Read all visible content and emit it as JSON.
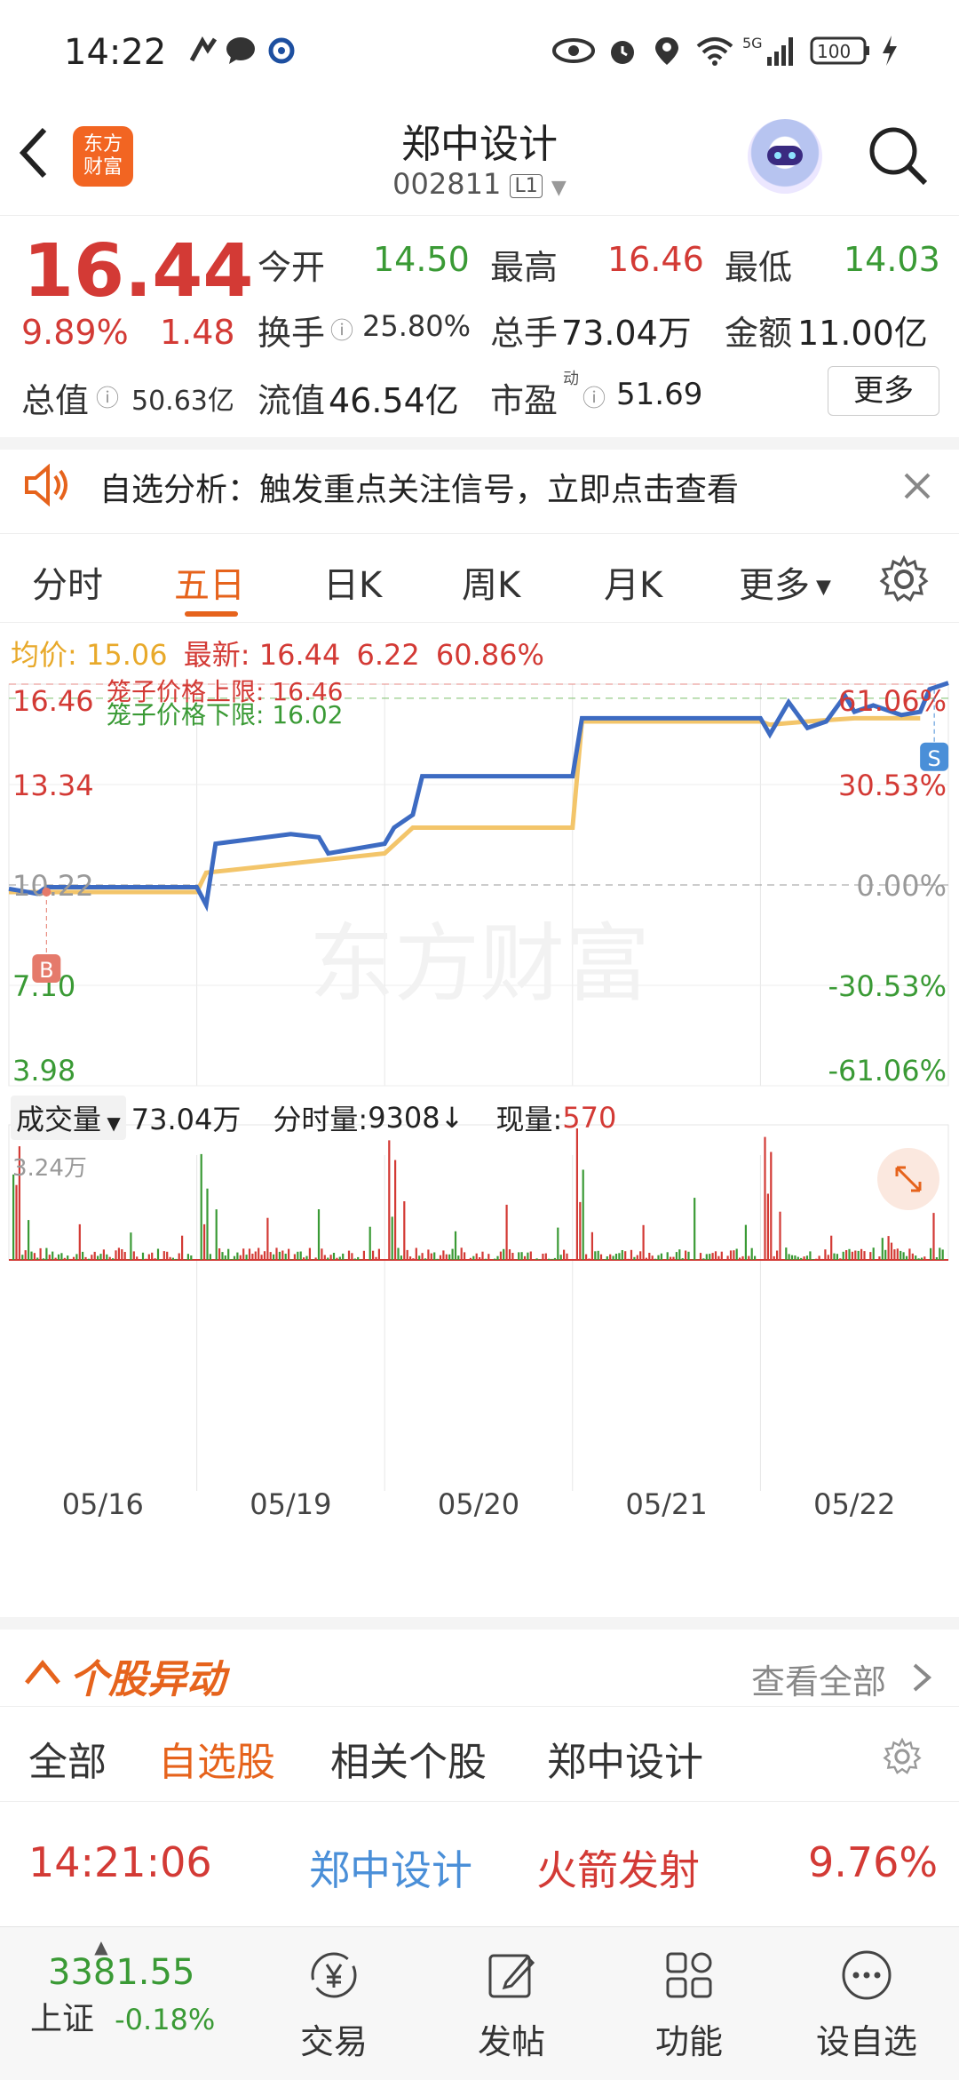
{
  "status_bar": {
    "time": "14:22",
    "battery": "100",
    "network": "5G"
  },
  "header": {
    "logo_text": "东方财富",
    "stock_name": "郑中设计",
    "stock_code": "002811",
    "level": "L1"
  },
  "quote": {
    "price": "16.44",
    "change_pct": "9.89%",
    "change_amt": "1.48",
    "stats": [
      {
        "label": "今开",
        "value": "14.50",
        "color": "green"
      },
      {
        "label": "最高",
        "value": "16.46",
        "color": "red"
      },
      {
        "label": "最低",
        "value": "14.03",
        "color": "green"
      },
      {
        "label": "换手",
        "value": "25.80%",
        "color": "dark"
      },
      {
        "label": "总手",
        "value": "73.04万",
        "color": "dark"
      },
      {
        "label": "金额",
        "value": "11.00亿",
        "color": "dark"
      },
      {
        "label": "总值",
        "value": "50.63亿",
        "color": "dark"
      },
      {
        "label": "流值",
        "value": "46.54亿",
        "color": "dark"
      },
      {
        "label": "市盈",
        "value": "51.69",
        "color": "dark",
        "superscript": "动"
      }
    ],
    "more_label": "更多"
  },
  "notice": {
    "text": "自选分析：触发重点关注信号，立即点击查看"
  },
  "tabs": [
    {
      "label": "分时",
      "active": false
    },
    {
      "label": "五日",
      "active": true
    },
    {
      "label": "日K",
      "active": false
    },
    {
      "label": "周K",
      "active": false
    },
    {
      "label": "月K",
      "active": false
    },
    {
      "label": "更多",
      "active": false
    }
  ],
  "info_line": {
    "avg_label": "均价:",
    "avg_value": "15.06",
    "latest_label": "最新:",
    "latest_value": "16.44",
    "change": "6.22",
    "change_pct": "60.86%"
  },
  "chart_data": {
    "type": "line",
    "title": "",
    "x": [
      "05/16",
      "05/19",
      "05/20",
      "05/21",
      "05/22"
    ],
    "price_axis": [
      "16.46",
      "13.34",
      "10.22",
      "7.10",
      "3.98"
    ],
    "pct_axis": [
      "61.06%",
      "30.53%",
      "0.00%",
      "-30.53%",
      "-61.06%"
    ],
    "ylim": [
      3.98,
      16.46
    ],
    "reference_price": 10.22,
    "cage_upper_label": "笼子价格上限: 16.46",
    "cage_lower_label": "笼子价格下限: 16.02",
    "series": [
      {
        "name": "最新",
        "color": "#3d6bc2",
        "values": [
          [
            0,
            10.1
          ],
          [
            0.03,
            9.95
          ],
          [
            0.04,
            10.15
          ],
          [
            0.2,
            10.15
          ],
          [
            0.21,
            9.6
          ],
          [
            0.22,
            11.5
          ],
          [
            0.3,
            11.8
          ],
          [
            0.33,
            11.7
          ],
          [
            0.34,
            11.2
          ],
          [
            0.4,
            11.5
          ],
          [
            0.41,
            12.0
          ],
          [
            0.43,
            12.4
          ],
          [
            0.44,
            13.6
          ],
          [
            0.6,
            13.6
          ],
          [
            0.61,
            15.4
          ],
          [
            0.8,
            15.4
          ],
          [
            0.81,
            14.9
          ],
          [
            0.83,
            15.9
          ],
          [
            0.85,
            15.1
          ],
          [
            0.87,
            15.3
          ],
          [
            0.89,
            16.1
          ],
          [
            0.9,
            15.6
          ],
          [
            0.92,
            15.8
          ],
          [
            0.95,
            15.5
          ],
          [
            0.97,
            15.6
          ],
          [
            0.98,
            16.3
          ],
          [
            1.0,
            16.5
          ]
        ]
      },
      {
        "name": "均价",
        "color": "#f3c56a",
        "values": [
          [
            0,
            10.0
          ],
          [
            0.2,
            10.0
          ],
          [
            0.21,
            10.6
          ],
          [
            0.4,
            11.2
          ],
          [
            0.43,
            12.0
          ],
          [
            0.6,
            12.0
          ],
          [
            0.61,
            15.3
          ],
          [
            0.8,
            15.3
          ],
          [
            0.81,
            15.2
          ],
          [
            0.85,
            15.3
          ],
          [
            0.9,
            15.4
          ],
          [
            0.97,
            15.4
          ]
        ]
      }
    ],
    "markers": [
      {
        "label": "B",
        "color": "#e57a6b"
      },
      {
        "label": "S",
        "color": "#4a8fd8"
      }
    ],
    "watermark": "东方财富"
  },
  "volume": {
    "dropdown_label": "成交量",
    "total": "73.04万",
    "minute_label": "分时量:",
    "minute_value": "9308",
    "current_label": "现量:",
    "current_value": "570",
    "max_label": "3.24万"
  },
  "movement": {
    "title": "个股异动",
    "view_all": "查看全部"
  },
  "filters": [
    {
      "label": "全部",
      "active": false
    },
    {
      "label": "自选股",
      "active": true
    },
    {
      "label": "相关个股",
      "active": false
    },
    {
      "label": "郑中设计",
      "active": false
    }
  ],
  "event": {
    "time": "14:21:06",
    "stock": "郑中设计",
    "signal": "火箭发射",
    "pct": "9.76%"
  },
  "bottom_nav": {
    "index_value": "3381.55",
    "index_name": "上证",
    "index_change": "-0.18%",
    "items": [
      {
        "label": "交易",
        "icon": "yen-exchange-icon"
      },
      {
        "label": "发帖",
        "icon": "edit-icon"
      },
      {
        "label": "功能",
        "icon": "grid-icon"
      },
      {
        "label": "设自选",
        "icon": "more-dots-icon"
      }
    ]
  }
}
